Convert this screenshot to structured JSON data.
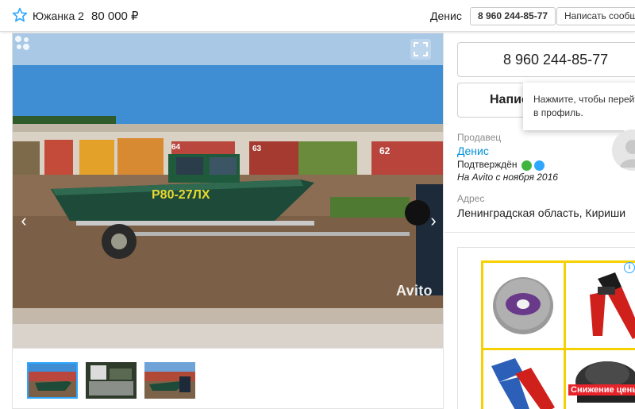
{
  "header": {
    "title": "Южанка 2",
    "price": "80 000 ₽",
    "seller": "Денис",
    "phone": "8 960 244-85-77",
    "write_label": "Написать сообщение"
  },
  "gallery": {
    "watermark": "Avito",
    "plate": "Р80-27ЛХ",
    "garage_numbers": [
      "64",
      "63",
      "62"
    ],
    "prev_icon": "‹",
    "next_icon": "›"
  },
  "contact": {
    "phone": "8 960 244-85-77",
    "write_label": "Написать",
    "tooltip": "Нажмите, чтобы перейти в профиль."
  },
  "seller": {
    "label": "Продавец",
    "name": "Денис",
    "verified": "Подтверждён",
    "since": "На Avito с ноября 2016"
  },
  "address": {
    "label": "Адрес",
    "value": "Ленинградская область, Кириши"
  },
  "ad": {
    "info": "i",
    "badge": "Снижение цены"
  },
  "colors": {
    "accent": "#0091d9",
    "star": "#2fa7ff",
    "ad_border": "#f6d000",
    "badge": "#e8232a"
  }
}
